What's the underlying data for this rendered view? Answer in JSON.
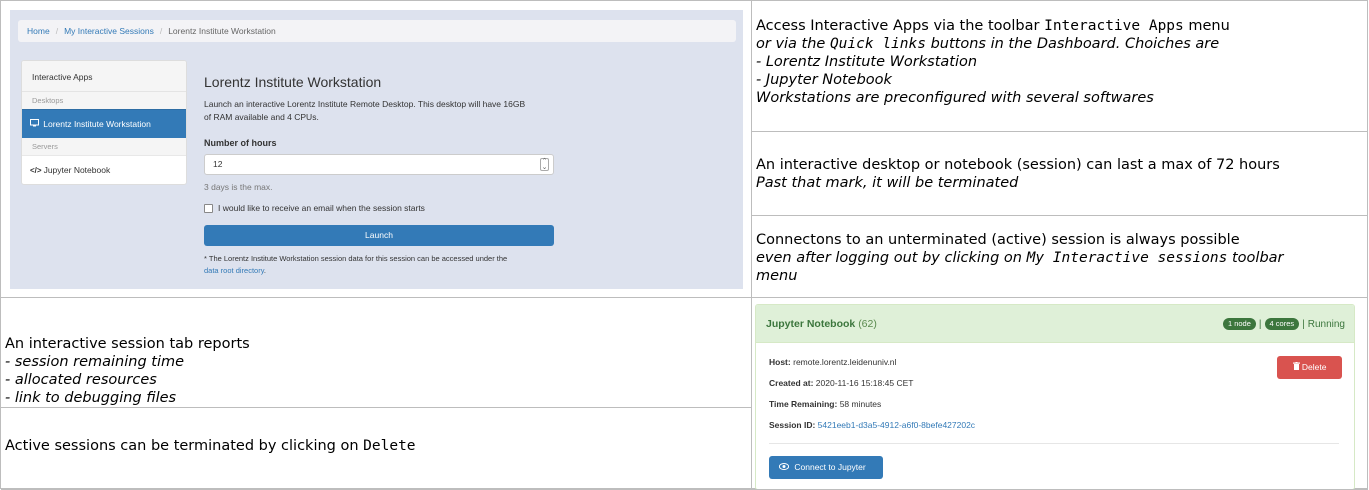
{
  "screenshot1": {
    "breadcrumb": {
      "home": "Home",
      "sessions": "My Interactive Sessions",
      "current": "Lorentz Institute Workstation",
      "separator": "/"
    },
    "sidebar": {
      "header": "Interactive Apps",
      "desktops_label": "Desktops",
      "desktop_item": "Lorentz Institute Workstation",
      "servers_label": "Servers",
      "server_item": "Jupyter Notebook",
      "desktop_icon": "monitor-icon",
      "server_icon": "code-icon"
    },
    "form": {
      "title": "Lorentz Institute Workstation",
      "description": "Launch an interactive Lorentz Institute Remote Desktop. This desktop will have 16GB of RAM available and 4 CPUs.",
      "hours_label": "Number of hours",
      "hours_value": "12",
      "hours_hint": "3 days is the max.",
      "email_checkbox": "I would like to receive an email when the session starts",
      "launch_button": "Launch",
      "note_text": "* The Lorentz Institute Workstation session data for this session can be accessed under the",
      "note_link": "data root directory",
      "note_end": "."
    }
  },
  "cells": {
    "r1": {
      "line1_pre": "Access Interactive Apps via the toolbar ",
      "line1_code": "Interactive Apps",
      "line1_post": " menu",
      "line2_pre": "or via the ",
      "line2_code": "Quick links",
      "line2_post": " buttons in the Dashboard. Choiches are",
      "line3": "- Lorentz Institute Workstation",
      "line4": "- Jupyter Notebook",
      "line5": "Workstations are preconfigured with several softwares"
    },
    "r2": {
      "line1": "An interactive desktop or notebook (session) can last a max of 72 hours",
      "line2": "Past that mark, it will be terminated"
    },
    "r3": {
      "line1": "Connectons to an unterminated (active) session is always possible",
      "line2_pre": "even after logging out by clicking on ",
      "line2_code": "My Interactive sessions",
      "line2_post": " toolbar",
      "line3": "menu"
    },
    "l4": {
      "line1": "An interactive session tab reports",
      "line2": "- session remaining time",
      "line3": "- allocated resources",
      "line4": "- link to debugging files"
    },
    "l5": {
      "line1_pre": "Active sessions can be terminated by clicking on ",
      "line1_code": "Delete"
    }
  },
  "screenshot2": {
    "title": "Jupyter Notebook",
    "count": "(62)",
    "badge_nodes": "1 node",
    "badge_cores": "4 cores",
    "separator": "|",
    "status": "Running",
    "host_label": "Host:",
    "host_value": "remote.lorentz.leidenuniv.nl",
    "created_label": "Created at:",
    "created_value": "2020-11-16 15:18:45 CET",
    "remaining_label": "Time Remaining:",
    "remaining_value": "58 minutes",
    "session_label": "Session ID:",
    "session_value": "5421eeb1-d3a5-4912-a6f0-8befe427202c",
    "delete_button": "Delete",
    "delete_icon": "trash-icon",
    "connect_button": "Connect to Jupyter",
    "connect_icon": "eye-icon"
  }
}
